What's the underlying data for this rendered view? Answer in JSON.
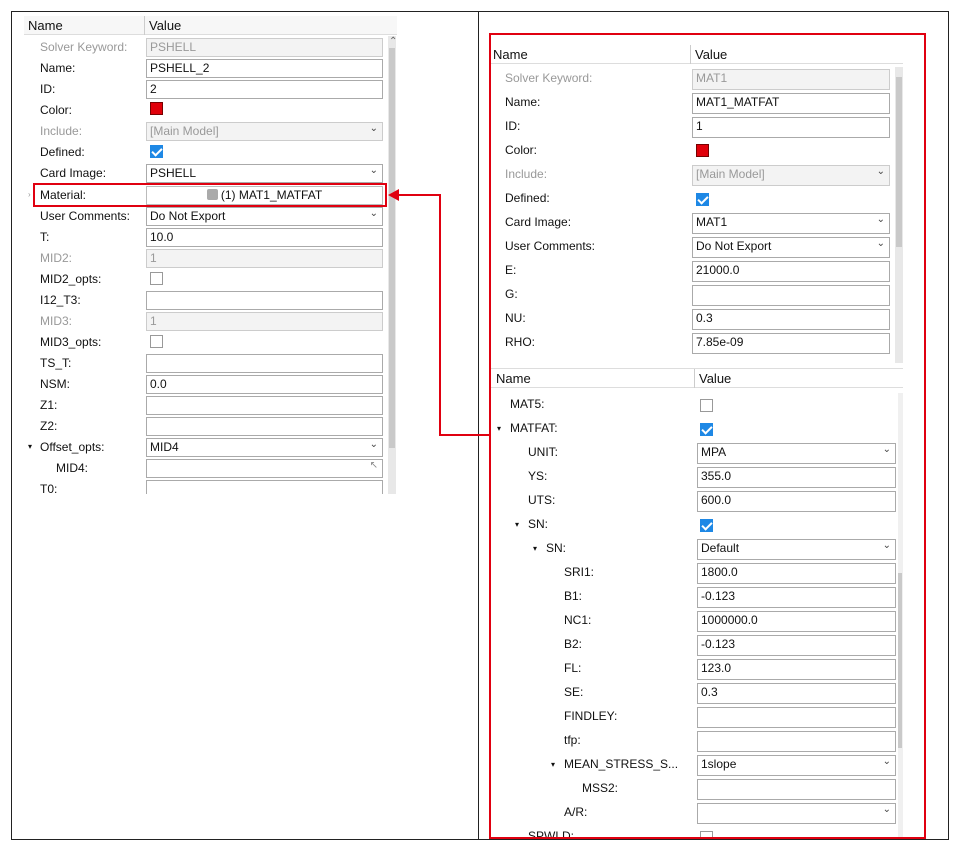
{
  "left_panel": {
    "header": {
      "name": "Name",
      "value": "Value"
    },
    "rows": [
      {
        "label": "Solver Keyword:",
        "value": "PSHELL"
      },
      {
        "label": "Name:",
        "value": "PSHELL_2"
      },
      {
        "label": "ID:",
        "value": "2"
      },
      {
        "label": "Color:"
      },
      {
        "label": "Include:",
        "value": "[Main Model]"
      },
      {
        "label": "Defined:"
      },
      {
        "label": "Card Image:",
        "value": "PSHELL"
      },
      {
        "label": "Material:",
        "value": "(1) MAT1_MATFAT"
      },
      {
        "label": "User Comments:",
        "value": "Do Not Export"
      },
      {
        "label": "T:",
        "value": "10.0"
      },
      {
        "label": "MID2:",
        "value": "1"
      },
      {
        "label": "MID2_opts:"
      },
      {
        "label": "I12_T3:",
        "value": ""
      },
      {
        "label": "MID3:",
        "value": "1"
      },
      {
        "label": "MID3_opts:"
      },
      {
        "label": "TS_T:",
        "value": ""
      },
      {
        "label": "NSM:",
        "value": "0.0"
      },
      {
        "label": "Z1:",
        "value": ""
      },
      {
        "label": "Z2:",
        "value": ""
      },
      {
        "label": "Offset_opts:",
        "value": "MID4"
      },
      {
        "label": "MID4:",
        "value": ""
      },
      {
        "label": "T0:",
        "value": ""
      }
    ]
  },
  "right_top": {
    "header": {
      "name": "Name",
      "value": "Value"
    },
    "rows": [
      {
        "label": "Solver Keyword:",
        "value": "MAT1"
      },
      {
        "label": "Name:",
        "value": "MAT1_MATFAT"
      },
      {
        "label": "ID:",
        "value": "1"
      },
      {
        "label": "Color:"
      },
      {
        "label": "Include:",
        "value": "[Main Model]"
      },
      {
        "label": "Defined:"
      },
      {
        "label": "Card Image:",
        "value": "MAT1"
      },
      {
        "label": "User Comments:",
        "value": "Do Not Export"
      },
      {
        "label": "E:",
        "value": "21000.0"
      },
      {
        "label": "G:",
        "value": ""
      },
      {
        "label": "NU:",
        "value": "0.3"
      },
      {
        "label": "RHO:",
        "value": "7.85e-09"
      }
    ]
  },
  "right_bottom": {
    "header": {
      "name": "Name",
      "value": "Value"
    },
    "rows": [
      {
        "label": "MAT5:"
      },
      {
        "label": "MATFAT:"
      },
      {
        "label": "UNIT:",
        "value": "MPA"
      },
      {
        "label": "YS:",
        "value": "355.0"
      },
      {
        "label": "UTS:",
        "value": "600.0"
      },
      {
        "label": "SN:"
      },
      {
        "label": "SN:",
        "value": "Default"
      },
      {
        "label": "SRI1:",
        "value": "1800.0"
      },
      {
        "label": "B1:",
        "value": "-0.123"
      },
      {
        "label": "NC1:",
        "value": "1000000.0"
      },
      {
        "label": "B2:",
        "value": "-0.123"
      },
      {
        "label": "FL:",
        "value": "123.0"
      },
      {
        "label": "SE:",
        "value": "0.3"
      },
      {
        "label": "FINDLEY:",
        "value": ""
      },
      {
        "label": "tfp:",
        "value": ""
      },
      {
        "label": "MEAN_STRESS_S...",
        "value": "1slope"
      },
      {
        "label": "MSS2:",
        "value": ""
      },
      {
        "label": "A/R:",
        "value": ""
      },
      {
        "label": "SPWLD:"
      }
    ]
  },
  "colors": {
    "highlight": "#e00010",
    "check": "#1e88e5",
    "swatch": "#e0000a"
  }
}
